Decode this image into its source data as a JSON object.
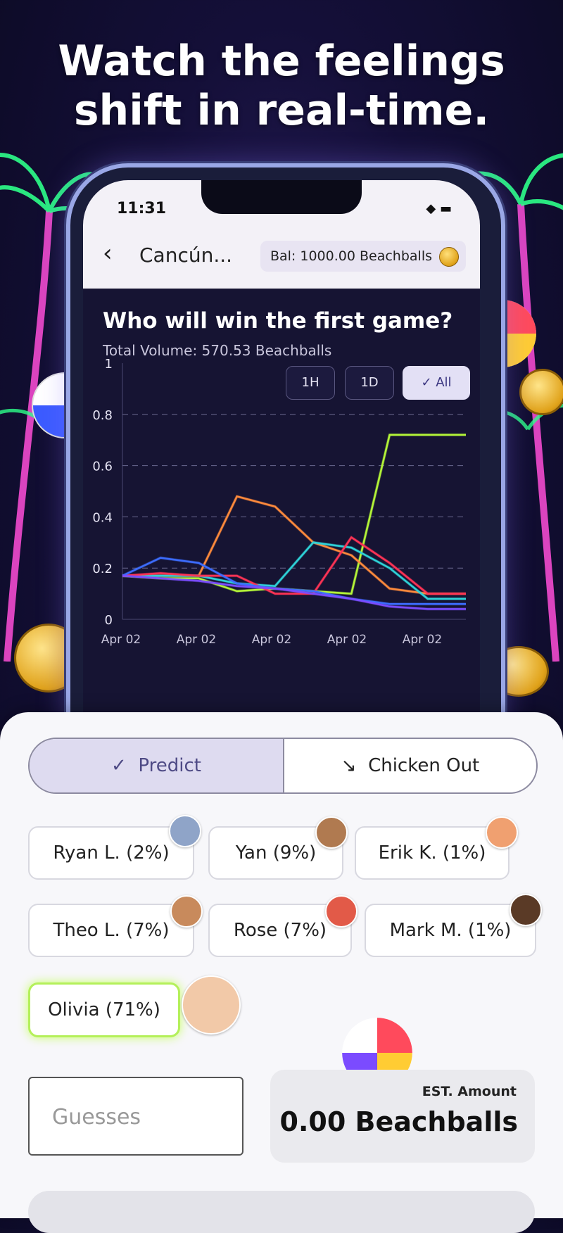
{
  "headline": {
    "line1": "Watch the feelings",
    "line2": "shift in real-time."
  },
  "status_bar": {
    "time": "11:31",
    "icons": "◆ ▬"
  },
  "nav": {
    "back_icon": "‹",
    "title": "Cancún...",
    "balance": "Bal: 1000.00 Beachballs"
  },
  "market": {
    "question": "Who will win the first game?",
    "volume": "Total Volume: 570.53 Beachballs",
    "ranges": [
      "1H",
      "1D",
      "✓ All"
    ],
    "active_range": "All"
  },
  "chart_data": {
    "type": "line",
    "x": [
      "Apr 02",
      "Apr 02",
      "Apr 02",
      "Apr 02",
      "Apr 02"
    ],
    "ylim": [
      0,
      1
    ],
    "yticks": [
      "1",
      "0.8",
      "0.6",
      "0.4",
      "0.2",
      "0"
    ],
    "grid": "dashed horizontal",
    "series": [
      {
        "color": "#b4f538",
        "values": [
          0.17,
          0.16,
          0.16,
          0.11,
          0.12,
          0.11,
          0.1,
          0.72,
          0.72,
          0.72
        ]
      },
      {
        "color": "#ff8a3c",
        "values": [
          0.17,
          0.17,
          0.17,
          0.48,
          0.44,
          0.3,
          0.25,
          0.12,
          0.1,
          0.1
        ]
      },
      {
        "color": "#2ed2d8",
        "values": [
          0.17,
          0.17,
          0.17,
          0.14,
          0.13,
          0.3,
          0.28,
          0.2,
          0.08,
          0.08
        ]
      },
      {
        "color": "#ff3355",
        "values": [
          0.17,
          0.18,
          0.17,
          0.17,
          0.1,
          0.1,
          0.32,
          0.22,
          0.1,
          0.1
        ]
      },
      {
        "color": "#3c6cff",
        "values": [
          0.17,
          0.24,
          0.22,
          0.14,
          0.12,
          0.11,
          0.08,
          0.06,
          0.06,
          0.06
        ]
      },
      {
        "color": "#7a4cff",
        "values": [
          0.17,
          0.16,
          0.15,
          0.13,
          0.12,
          0.1,
          0.08,
          0.05,
          0.04,
          0.04
        ]
      }
    ]
  },
  "actions": {
    "predict": "Predict",
    "predict_icon": "✓",
    "chicken": "Chicken Out",
    "chicken_icon": "↘"
  },
  "choices": [
    {
      "label": "Ryan L. (2%)"
    },
    {
      "label": "Yan (9%)"
    },
    {
      "label": "Erik K. (1%)"
    },
    {
      "label": "Theo L. (7%)"
    },
    {
      "label": "Rose (7%)"
    },
    {
      "label": "Mark M. (1%)"
    },
    {
      "label": "Olivia (71%)"
    }
  ],
  "selected_choice": "Olivia (71%)",
  "guesses_placeholder": "Guesses",
  "estimate": {
    "label": "EST. Amount",
    "value": "0.00 Beachballs"
  }
}
